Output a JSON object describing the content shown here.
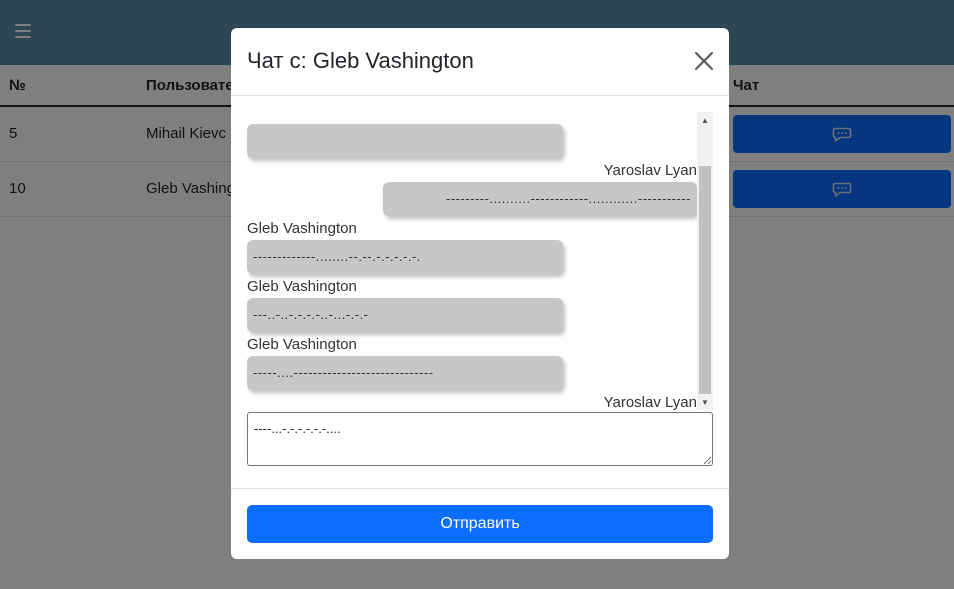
{
  "header": {
    "menu_icon": "hamburger-icon"
  },
  "table": {
    "columns": [
      "№",
      "Пользовате",
      "Чат"
    ],
    "rows": [
      {
        "num": "5",
        "user": "Mihail Kievc",
        "chat_icon": "chat-bubble-icon"
      },
      {
        "num": "10",
        "user": "Gleb Vashing",
        "chat_icon": "chat-bubble-icon"
      }
    ]
  },
  "modal": {
    "title": "Чат с: Gleb Vashington",
    "close_icon": "close-icon",
    "messages": [
      {
        "side": "in",
        "author": "",
        "text": ""
      },
      {
        "side": "out",
        "author": "Yaroslav Lyan",
        "text": "---------..........------------............-----------"
      },
      {
        "side": "in",
        "author": "Gleb Vashington",
        "text": "-------------........--.--.-.-.-.-.-."
      },
      {
        "side": "in",
        "author": "Gleb Vashington",
        "text": "---..-..-.-.-.-..-...-.-.-"
      },
      {
        "side": "in",
        "author": "Gleb Vashington",
        "text": "-----....-----------------------------"
      },
      {
        "side": "out",
        "author": "Yaroslav Lyan",
        "text": "----....-.--..-...--.---.."
      }
    ],
    "input_value": "----...-.-.-.-.-.-....",
    "send_label": "Отправить"
  }
}
